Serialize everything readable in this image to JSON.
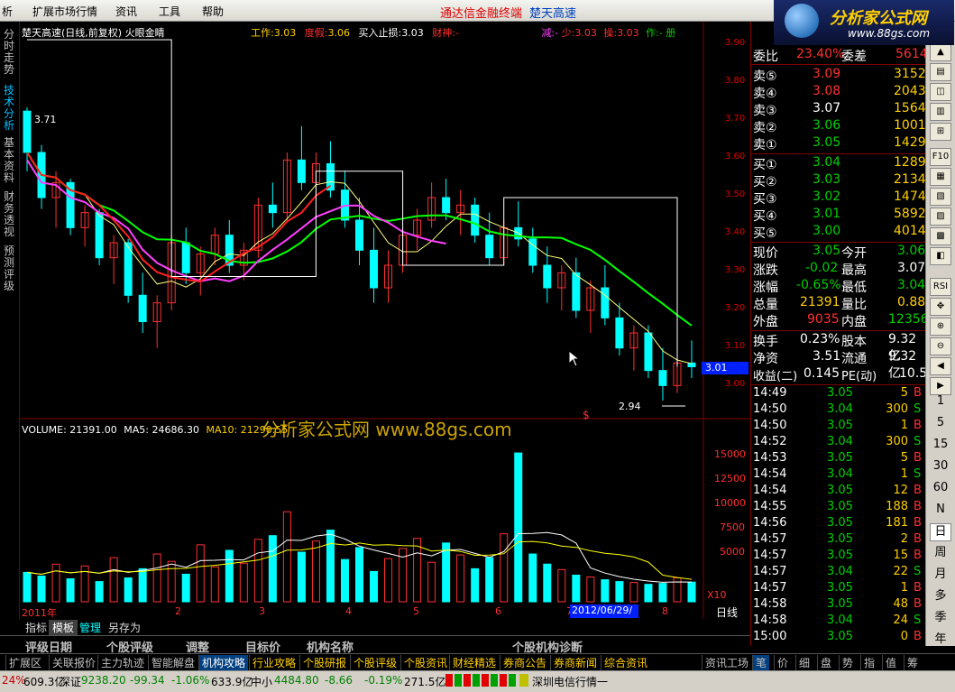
{
  "menu": {
    "items": [
      "析",
      "扩展市场行情",
      "资讯",
      "工具",
      "帮助"
    ]
  },
  "brand": {
    "red": "通达信金融终端",
    "blue": "楚天高速"
  },
  "logo": {
    "text": "分析家公式网",
    "url": "www.88gs.com"
  },
  "left_tabs": [
    "分时走势",
    "技术分析",
    "基本资料",
    "财务透视",
    "预测评级"
  ],
  "chart_header": {
    "title": "楚天高速(日线,前复权) 火眼金睛",
    "work_label": "工作:",
    "work_value": "3.03",
    "dujia_label": "度假:",
    "dujia_value": "3.06",
    "buy_label": "买入止损:",
    "buy_value": "3.03",
    "caishen_label": "财神:",
    "caishen_value": "-",
    "jian_label": "减:",
    "jian_value": "-",
    "shao_label": "少:",
    "shao_value": "3.03",
    "cao_label": "操:",
    "cao_value": "3.03",
    "zuo_label": "作:",
    "zuo_value": "- 册"
  },
  "price_axis": [
    "3.90",
    "3.80",
    "3.70",
    "3.60",
    "3.50",
    "3.40",
    "3.30",
    "3.20",
    "3.10",
    "3.00"
  ],
  "current_price_tag": "3.01",
  "kline_annotations": {
    "high": "3.71",
    "low": "2.94",
    "dollar": "$"
  },
  "vol_header": {
    "volume_label": "VOLUME:",
    "volume_value": "21391.00",
    "ma5_label": "MA5:",
    "ma5_value": "24686.30",
    "ma10_label": "MA10:",
    "ma10_value": "21290.55"
  },
  "watermark": "分析家公式网  www.88gs.com",
  "vol_axis": [
    "15000",
    "12500",
    "10000",
    "7500",
    "5000"
  ],
  "vol_unit": "X10",
  "x_axis": [
    "2011年",
    "2",
    "3",
    "4",
    "5",
    "6",
    "7",
    "8"
  ],
  "date_tag": "2012/06/29/五",
  "period": "日线",
  "zoom_controls": "+ - ○",
  "chart_data": {
    "type": "candlestick",
    "ylim": [
      2.94,
      3.9
    ],
    "ohlc_estimated": [
      [
        3.71,
        3.72,
        3.55,
        3.6
      ],
      [
        3.6,
        3.62,
        3.45,
        3.48
      ],
      [
        3.48,
        3.55,
        3.4,
        3.52
      ],
      [
        3.52,
        3.53,
        3.38,
        3.4
      ],
      [
        3.4,
        3.46,
        3.35,
        3.44
      ],
      [
        3.44,
        3.45,
        3.3,
        3.32
      ],
      [
        3.32,
        3.38,
        3.25,
        3.36
      ],
      [
        3.36,
        3.37,
        3.2,
        3.22
      ],
      [
        3.22,
        3.28,
        3.12,
        3.15
      ],
      [
        3.15,
        3.22,
        3.08,
        3.2
      ],
      [
        3.2,
        3.38,
        3.18,
        3.36
      ],
      [
        3.36,
        3.4,
        3.25,
        3.28
      ],
      [
        3.28,
        3.35,
        3.22,
        3.33
      ],
      [
        3.33,
        3.4,
        3.3,
        3.38
      ],
      [
        3.38,
        3.42,
        3.28,
        3.3
      ],
      [
        3.3,
        3.36,
        3.26,
        3.34
      ],
      [
        3.34,
        3.48,
        3.32,
        3.46
      ],
      [
        3.46,
        3.52,
        3.4,
        3.44
      ],
      [
        3.44,
        3.6,
        3.42,
        3.58
      ],
      [
        3.58,
        3.67,
        3.5,
        3.52
      ],
      [
        3.52,
        3.6,
        3.48,
        3.57
      ],
      [
        3.57,
        3.63,
        3.48,
        3.5
      ],
      [
        3.5,
        3.55,
        3.4,
        3.42
      ],
      [
        3.42,
        3.48,
        3.3,
        3.34
      ],
      [
        3.34,
        3.4,
        3.2,
        3.24
      ],
      [
        3.24,
        3.34,
        3.2,
        3.3
      ],
      [
        3.3,
        3.4,
        3.28,
        3.38
      ],
      [
        3.38,
        3.45,
        3.34,
        3.42
      ],
      [
        3.42,
        3.52,
        3.4,
        3.48
      ],
      [
        3.48,
        3.53,
        3.42,
        3.44
      ],
      [
        3.44,
        3.5,
        3.38,
        3.46
      ],
      [
        3.46,
        3.48,
        3.36,
        3.38
      ],
      [
        3.38,
        3.44,
        3.3,
        3.32
      ],
      [
        3.32,
        3.42,
        3.3,
        3.4
      ],
      [
        3.4,
        3.47,
        3.35,
        3.37
      ],
      [
        3.37,
        3.4,
        3.28,
        3.3
      ],
      [
        3.3,
        3.35,
        3.2,
        3.24
      ],
      [
        3.24,
        3.3,
        3.18,
        3.28
      ],
      [
        3.28,
        3.32,
        3.16,
        3.18
      ],
      [
        3.18,
        3.26,
        3.12,
        3.24
      ],
      [
        3.24,
        3.3,
        3.14,
        3.16
      ],
      [
        3.16,
        3.2,
        3.06,
        3.08
      ],
      [
        3.08,
        3.14,
        3.02,
        3.12
      ],
      [
        3.12,
        3.14,
        3.0,
        3.02
      ],
      [
        3.02,
        3.08,
        2.94,
        2.98
      ],
      [
        2.98,
        3.06,
        2.96,
        3.04
      ],
      [
        3.04,
        3.1,
        3.0,
        3.03
      ]
    ],
    "volume_estimated": [
      3200,
      2800,
      4100,
      2500,
      3900,
      2200,
      4800,
      2600,
      3600,
      5200,
      4400,
      3000,
      6200,
      3800,
      5600,
      4200,
      6800,
      7200,
      9800,
      5400,
      6600,
      7800,
      4600,
      5900,
      3300,
      4700,
      5800,
      6900,
      4300,
      6400,
      5100,
      3600,
      4800,
      7400,
      16200,
      5200,
      4100,
      3500,
      2900,
      2700,
      2400,
      2200,
      2100,
      1900,
      2000,
      2600,
      2139
    ],
    "ma_lines": [
      "MA5 (yellow)",
      "MA20 (green)",
      "signal (red/magenta)"
    ]
  },
  "quote": {
    "weibi_label": "委比",
    "weibi_value": "23.40%",
    "weicha_label": "委差",
    "weicha_value": "5614",
    "asks": [
      {
        "label": "卖⑤",
        "price": "3.09",
        "vol": "3152"
      },
      {
        "label": "卖④",
        "price": "3.08",
        "vol": "2043"
      },
      {
        "label": "卖③",
        "price": "3.07",
        "vol": "1564"
      },
      {
        "label": "卖②",
        "price": "3.06",
        "vol": "1001"
      },
      {
        "label": "卖①",
        "price": "3.05",
        "vol": "1429"
      }
    ],
    "bids": [
      {
        "label": "买①",
        "price": "3.04",
        "vol": "1289"
      },
      {
        "label": "买②",
        "price": "3.03",
        "vol": "2134"
      },
      {
        "label": "买③",
        "price": "3.02",
        "vol": "1474"
      },
      {
        "label": "买④",
        "price": "3.01",
        "vol": "5892"
      },
      {
        "label": "买⑤",
        "price": "3.00",
        "vol": "4014"
      }
    ],
    "stats": [
      {
        "l1": "现价",
        "v1": "3.05",
        "l2": "今开",
        "v2": "3.06",
        "c1": "green",
        "c2": "green"
      },
      {
        "l1": "涨跌",
        "v1": "-0.02",
        "l2": "最高",
        "v2": "3.07",
        "c1": "green",
        "c2": "white"
      },
      {
        "l1": "涨幅",
        "v1": "-0.65%",
        "l2": "最低",
        "v2": "3.04",
        "c1": "green",
        "c2": "green"
      },
      {
        "l1": "总量",
        "v1": "21391",
        "l2": "量比",
        "v2": "0.88",
        "c1": "yellow",
        "c2": "yellow"
      },
      {
        "l1": "外盘",
        "v1": "9035",
        "l2": "内盘",
        "v2": "12356",
        "c1": "red",
        "c2": "green"
      }
    ],
    "fund": [
      {
        "l1": "换手",
        "v1": "0.23%",
        "l2": "股本",
        "v2": "9.32亿"
      },
      {
        "l1": "净资",
        "v1": "3.51",
        "l2": "流通",
        "v2": "9.32亿"
      },
      {
        "l1": "收益(二)",
        "v1": "0.145",
        "l2": "PE(动)",
        "v2": "10.5"
      }
    ],
    "ticks": [
      {
        "t": "14:49",
        "p": "3.05",
        "v": "5",
        "d": "B"
      },
      {
        "t": "14:50",
        "p": "3.04",
        "v": "300",
        "d": "S"
      },
      {
        "t": "14:50",
        "p": "3.05",
        "v": "1",
        "d": "B"
      },
      {
        "t": "14:52",
        "p": "3.04",
        "v": "300",
        "d": "S"
      },
      {
        "t": "14:53",
        "p": "3.05",
        "v": "5",
        "d": "B"
      },
      {
        "t": "14:54",
        "p": "3.04",
        "v": "1",
        "d": "S"
      },
      {
        "t": "14:54",
        "p": "3.05",
        "v": "12",
        "d": "B"
      },
      {
        "t": "14:55",
        "p": "3.05",
        "v": "188",
        "d": "B"
      },
      {
        "t": "14:56",
        "p": "3.05",
        "v": "181",
        "d": "B"
      },
      {
        "t": "14:57",
        "p": "3.05",
        "v": "2",
        "d": "B"
      },
      {
        "t": "14:57",
        "p": "3.05",
        "v": "15",
        "d": "B"
      },
      {
        "t": "14:57",
        "p": "3.04",
        "v": "22",
        "d": "S"
      },
      {
        "t": "14:57",
        "p": "3.05",
        "v": "1",
        "d": "B"
      },
      {
        "t": "14:58",
        "p": "3.05",
        "v": "48",
        "d": "B"
      },
      {
        "t": "14:58",
        "p": "3.04",
        "v": "24",
        "d": "S"
      },
      {
        "t": "15:00",
        "p": "3.05",
        "v": "0",
        "d": "B"
      }
    ]
  },
  "right_tools": {
    "icons": [
      "F10",
      "RSI"
    ],
    "texts": [
      "1",
      "5",
      "15",
      "30",
      "60",
      "N",
      "日",
      "周",
      "月",
      "多",
      "季",
      "年"
    ]
  },
  "tabs1": [
    "指标",
    "模板",
    "管理",
    "另存为"
  ],
  "tabs2": [
    "评级日期",
    "个股评级",
    "调整",
    "目标价",
    "机构名称",
    "个股机构诊断"
  ],
  "tabs3": [
    "扩展区",
    "关联报价",
    "主力轨迹",
    "智能解盘",
    "机构攻略",
    "行业攻略",
    "个股研报",
    "个股评级",
    "个股资讯",
    "财经精选",
    "券商公告",
    "券商新闻",
    "综合资讯",
    "资讯工场",
    "笔",
    "价",
    "细",
    "盘",
    "势",
    "指",
    "值",
    "筹"
  ],
  "status": {
    "s1": "24%",
    "s2": "609.3亿",
    "s3": "深证",
    "s4": "9238.20",
    "s5": "-99.34",
    "s6": "-1.06%",
    "s7": "633.9亿",
    "s8": "中小",
    "s9": "4484.80",
    "s10": "-8.66",
    "s11": "-0.19%",
    "s12": "271.5亿",
    "s13": "深圳电信行情一"
  }
}
